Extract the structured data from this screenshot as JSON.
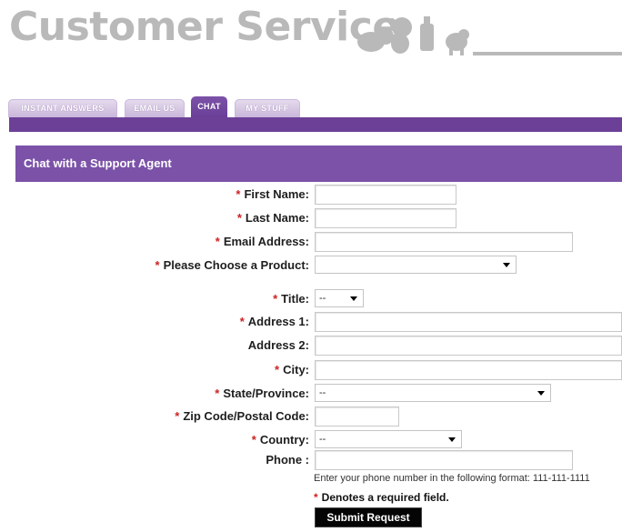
{
  "header": {
    "title": "Customer Service"
  },
  "tabs": [
    {
      "label": "INSTANT ANSWERS",
      "active": false
    },
    {
      "label": "EMAIL US",
      "active": false
    },
    {
      "label": "CHAT",
      "active": true
    },
    {
      "label": "MY STUFF",
      "active": false
    }
  ],
  "colors": {
    "accent": "#7b52a8",
    "tab_bar": "#6c4097",
    "required": "#cc2222"
  },
  "panel": {
    "title": "Chat with a Support Agent"
  },
  "form": {
    "required_mark": "*",
    "first_name": {
      "label": "First Name:",
      "value": ""
    },
    "last_name": {
      "label": "Last Name:",
      "value": ""
    },
    "email": {
      "label": "Email Address:",
      "value": ""
    },
    "product": {
      "label": "Please Choose a Product:",
      "value": ""
    },
    "title": {
      "label": "Title:",
      "value": "--"
    },
    "address1": {
      "label": "Address 1:",
      "value": ""
    },
    "address2": {
      "label": "Address 2:",
      "value": ""
    },
    "city": {
      "label": "City:",
      "value": ""
    },
    "state": {
      "label": "State/Province:",
      "value": "--"
    },
    "zip": {
      "label": "Zip Code/Postal Code:",
      "value": ""
    },
    "country": {
      "label": "Country:",
      "value": "--"
    },
    "phone": {
      "label": "Phone :",
      "value": ""
    },
    "phone_hint": "Enter your phone number in the following format: 111-111-1111",
    "required_note": "Denotes a required field.",
    "submit_label": "Submit Request"
  }
}
